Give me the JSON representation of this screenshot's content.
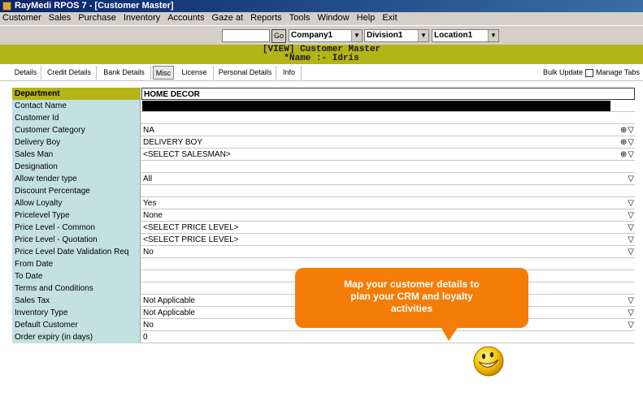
{
  "window": {
    "title": "RayMedi RPOS 7 - [Customer Master]"
  },
  "menu": [
    "Customer",
    "Sales",
    "Purchase",
    "Inventory",
    "Accounts",
    "Gaze at",
    "Reports",
    "Tools",
    "Window",
    "Help",
    "Exit"
  ],
  "toolbar": {
    "go_label": "Go",
    "company": "Company1",
    "division": "Division1",
    "location": "Location1"
  },
  "header": {
    "line1": "[VIEW]  Customer Master",
    "line2": "*Name :- Idris"
  },
  "tabs": [
    "Details",
    "Credit Details",
    "Bank Details",
    "Misc",
    "License",
    "Personal Details",
    "Info"
  ],
  "active_tab": "Misc",
  "actions": {
    "bulk_update": "Bulk Update",
    "manage_tabs": "Manage Tabs"
  },
  "form": {
    "department_label": "Department",
    "department_value": "HOME DECOR",
    "rows": [
      {
        "label": "Contact Name",
        "value": ""
      },
      {
        "label": "Customer Id",
        "value": ""
      },
      {
        "label": "Customer Category",
        "value": "NA"
      },
      {
        "label": "Delivery Boy",
        "value": "DELIVERY BOY"
      },
      {
        "label": "Sales Man",
        "value": "<SELECT SALESMAN>"
      },
      {
        "label": "Designation",
        "value": ""
      },
      {
        "label": "Allow tender type",
        "value": "All"
      },
      {
        "label": "Discount Percentage",
        "value": ""
      },
      {
        "label": "Allow Loyalty",
        "value": "Yes"
      },
      {
        "label": "Pricelevel Type",
        "value": "None"
      },
      {
        "label": "Price Level - Common",
        "value": "<SELECT PRICE LEVEL>"
      },
      {
        "label": "Price Level - Quotation",
        "value": "<SELECT PRICE LEVEL>"
      },
      {
        "label": "Price Level Date Validation Req",
        "value": "No"
      },
      {
        "label": "From Date",
        "value": ""
      },
      {
        "label": "To Date",
        "value": ""
      },
      {
        "label": "Terms and Conditions",
        "value": ""
      },
      {
        "label": "Sales Tax",
        "value": "Not Applicable"
      },
      {
        "label": "Inventory Type",
        "value": "Not Applicable"
      },
      {
        "label": "Default Customer",
        "value": "No"
      },
      {
        "label": "Order expiry (in days)",
        "value": "0"
      }
    ]
  },
  "callout": {
    "line1": "Map your customer details to",
    "line2": "plan your CRM and loyalty",
    "line3": "activities"
  },
  "colors": {
    "header_band": "#b5b416",
    "label_bg": "#c3e0e3",
    "callout": "#f37d08"
  }
}
